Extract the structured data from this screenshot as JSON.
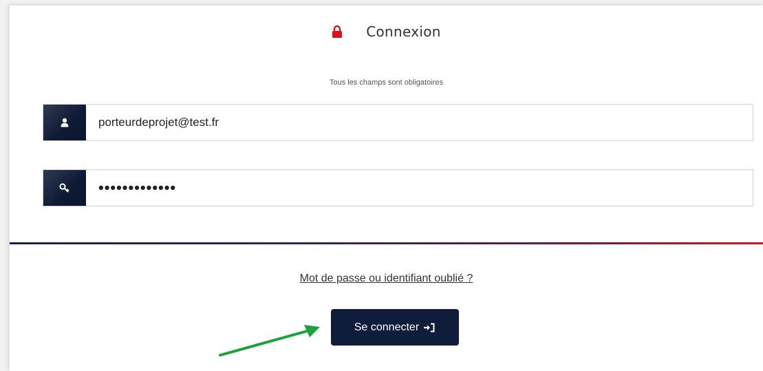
{
  "header": {
    "title": "Connexion",
    "lock_icon": "lock-icon",
    "accent_color": "#e0101e"
  },
  "form": {
    "required_notice": "Tous les champs sont obligatoires",
    "email": {
      "icon": "user-icon",
      "value": "porteurdeprojet@test.fr"
    },
    "password": {
      "icon": "key-icon",
      "value": "•••••••••••••"
    }
  },
  "footer": {
    "forgot_link": "Mot de passe ou identifiant oublié ?",
    "login_button": "Se connecter",
    "login_icon": "sign-in-icon",
    "button_color": "#0f1c3a"
  },
  "annotation": {
    "arrow_color": "#1aa33b"
  }
}
